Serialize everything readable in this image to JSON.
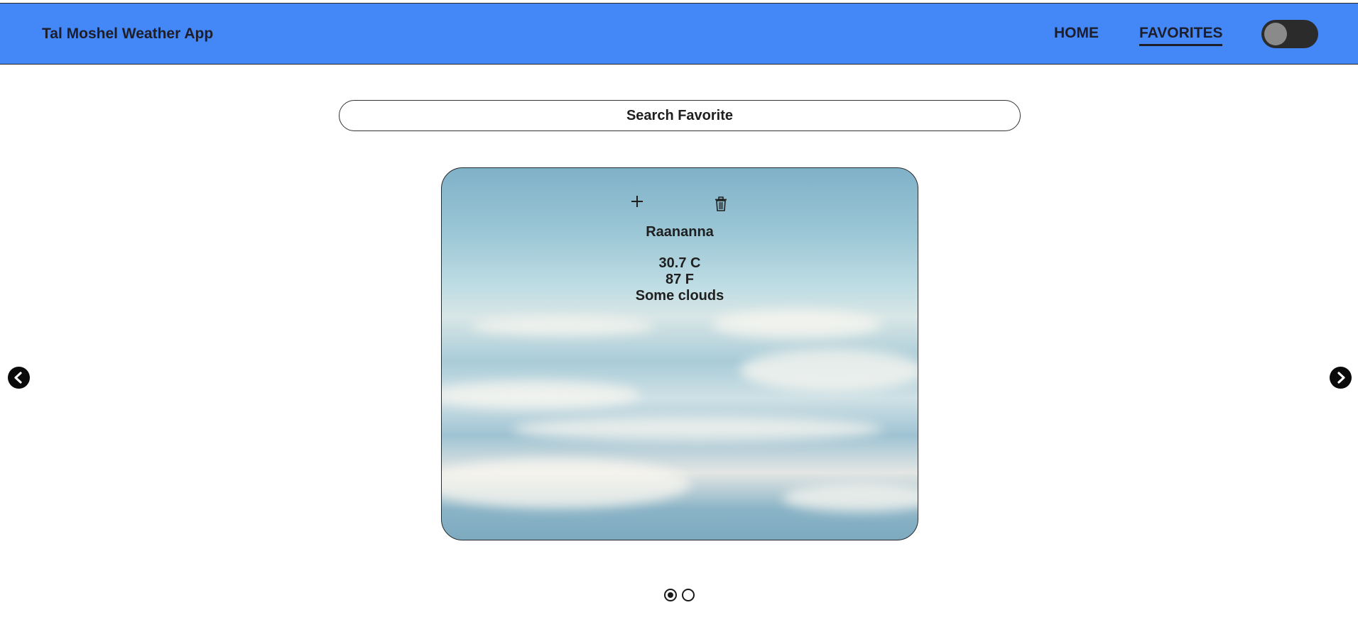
{
  "app": {
    "title": "Tal Moshel Weather App"
  },
  "nav": {
    "items": [
      {
        "label": "HOME",
        "active": false
      },
      {
        "label": "FAVORITES",
        "active": true
      }
    ],
    "theme_toggle_on": false
  },
  "search": {
    "placeholder": "Search Favorite",
    "value": ""
  },
  "card": {
    "add_icon": "plus-icon",
    "delete_icon": "trash-icon",
    "city": "Raananna",
    "temp_c": "30.7 C",
    "temp_f": "87 F",
    "condition": "Some clouds"
  },
  "carousel": {
    "prev_icon": "chevron-left-icon",
    "next_icon": "chevron-right-icon",
    "pages": 2,
    "active_page": 1
  },
  "colors": {
    "navbar": "#4487f7",
    "text": "#1f1f1f"
  }
}
